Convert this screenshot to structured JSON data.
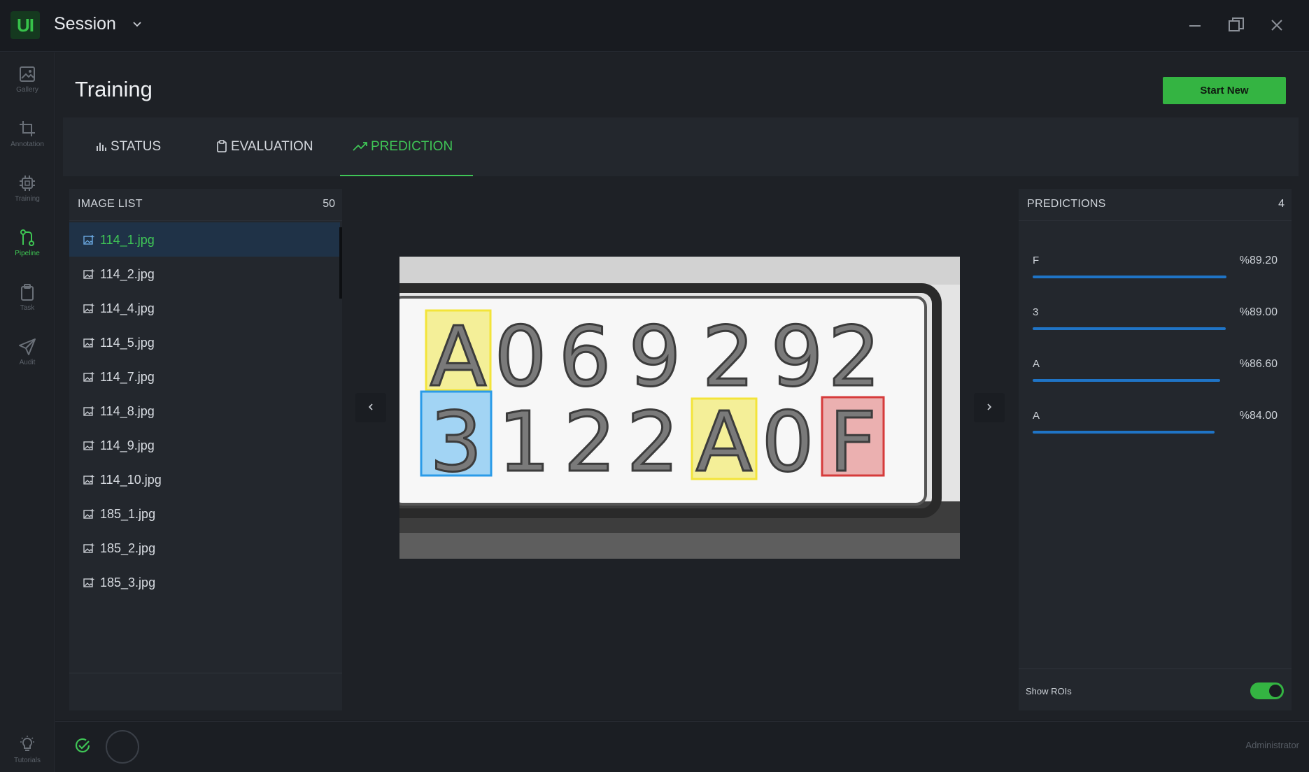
{
  "window": {
    "logo_text": "UI",
    "title": "Session",
    "icons": [
      "chevron-down-icon",
      "minimize-icon",
      "restore-icon",
      "close-icon"
    ]
  },
  "rail": {
    "items": [
      {
        "label": "Gallery",
        "icon": "image-icon",
        "active": false
      },
      {
        "label": "Annotation",
        "icon": "crop-icon",
        "active": false
      },
      {
        "label": "Training",
        "icon": "chip-icon",
        "active": false
      },
      {
        "label": "Pipeline",
        "icon": "pipeline-icon",
        "active": true
      },
      {
        "label": "Task",
        "icon": "clipboard-icon",
        "active": false
      },
      {
        "label": "Audit",
        "icon": "send-icon",
        "active": false
      }
    ],
    "tutorials": {
      "label": "Tutorials",
      "icon": "lightbulb-icon"
    }
  },
  "page": {
    "title": "Training",
    "start_button": "Start New"
  },
  "tabs": [
    {
      "label": "STATUS",
      "icon": "bar-chart-icon",
      "active": false
    },
    {
      "label": "EVALUATION",
      "icon": "clipboard-icon",
      "active": false
    },
    {
      "label": "PREDICTION",
      "icon": "trend-up-icon",
      "active": true
    }
  ],
  "image_list": {
    "title": "IMAGE LIST",
    "count": "50",
    "items": [
      {
        "name": "114_1.jpg",
        "selected": true
      },
      {
        "name": "114_2.jpg",
        "selected": false
      },
      {
        "name": "114_4.jpg",
        "selected": false
      },
      {
        "name": "114_5.jpg",
        "selected": false
      },
      {
        "name": "114_7.jpg",
        "selected": false
      },
      {
        "name": "114_8.jpg",
        "selected": false
      },
      {
        "name": "114_9.jpg",
        "selected": false
      },
      {
        "name": "114_10.jpg",
        "selected": false
      },
      {
        "name": "185_1.jpg",
        "selected": false
      },
      {
        "name": "185_2.jpg",
        "selected": false
      },
      {
        "name": "185_3.jpg",
        "selected": false
      }
    ]
  },
  "viewer": {
    "plate_row1": [
      "A",
      "0",
      "6",
      "9",
      "2",
      "9",
      "2"
    ],
    "plate_row2": [
      "3",
      "1",
      "2",
      "2",
      "A",
      "0",
      "F"
    ],
    "highlights": [
      {
        "char": "A",
        "color": "#f3ea4a"
      },
      {
        "char": "3",
        "color": "#39a8ef"
      },
      {
        "char": "A",
        "color": "#f3ea4a"
      },
      {
        "char": "F",
        "color": "#e06a6a"
      }
    ]
  },
  "predictions": {
    "title": "PREDICTIONS",
    "count": "4",
    "items": [
      {
        "label": "F",
        "score": "%89.20",
        "value": 0.892
      },
      {
        "label": "3",
        "score": "%89.00",
        "value": 0.89
      },
      {
        "label": "A",
        "score": "%86.60",
        "value": 0.866
      },
      {
        "label": "A",
        "score": "%84.00",
        "value": 0.84
      }
    ],
    "show_rois_label": "Show ROIs",
    "show_rois": true
  },
  "footer": {
    "user": "Administrator"
  }
}
